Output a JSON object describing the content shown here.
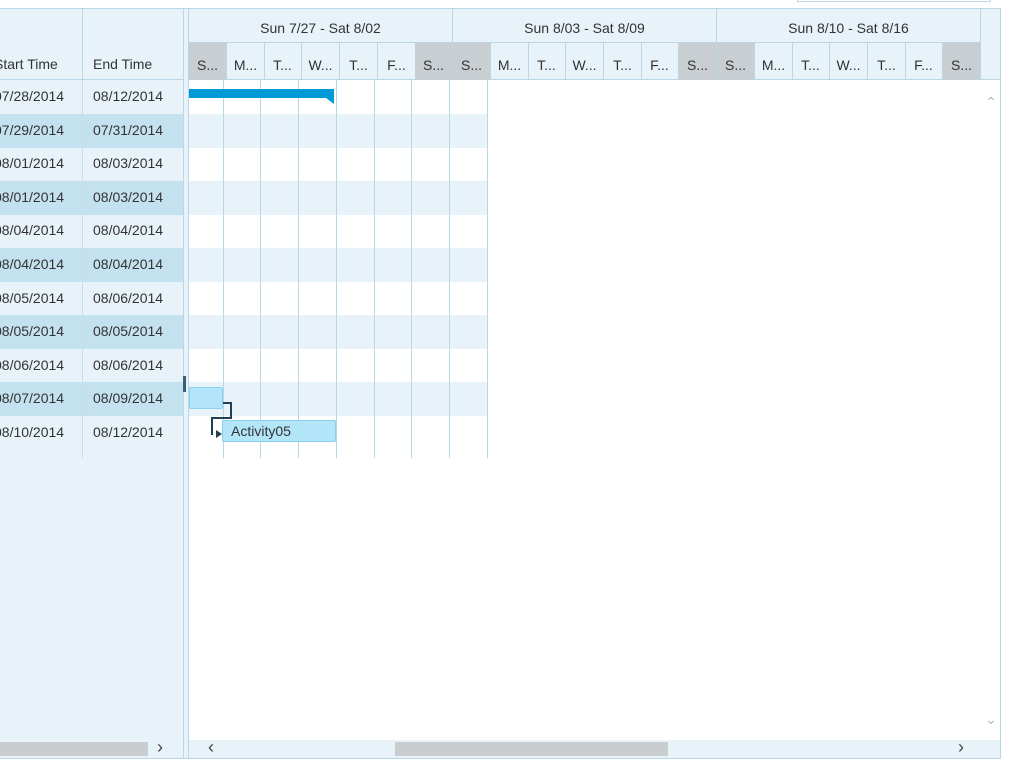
{
  "grid": {
    "columns": {
      "start_time": "Start Time",
      "end_time": "End Time"
    },
    "rows": [
      {
        "start": "07/28/2014",
        "end": "08/12/2014"
      },
      {
        "start": "07/29/2014",
        "end": "07/31/2014"
      },
      {
        "start": "08/01/2014",
        "end": "08/03/2014"
      },
      {
        "start": "08/01/2014",
        "end": "08/03/2014"
      },
      {
        "start": "08/04/2014",
        "end": "08/04/2014"
      },
      {
        "start": "08/04/2014",
        "end": "08/04/2014"
      },
      {
        "start": "08/05/2014",
        "end": "08/06/2014"
      },
      {
        "start": "08/05/2014",
        "end": "08/05/2014"
      },
      {
        "start": "08/06/2014",
        "end": "08/06/2014"
      },
      {
        "start": "08/07/2014",
        "end": "08/09/2014"
      },
      {
        "start": "08/10/2014",
        "end": "08/12/2014"
      }
    ],
    "scroll_right_glyph": "›"
  },
  "timeline": {
    "weeks": [
      "Sun 7/27 - Sat 8/02",
      "Sun 8/03 - Sat 8/09",
      "Sun 8/10 - Sat 8/16"
    ],
    "days": [
      "S...",
      "M...",
      "T...",
      "W...",
      "T...",
      "F...",
      "S...",
      "S...",
      "M...",
      "T...",
      "W...",
      "T...",
      "F...",
      "S...",
      "S...",
      "M...",
      "T...",
      "W...",
      "T...",
      "F...",
      "S..."
    ],
    "weekend_flags": [
      true,
      false,
      false,
      false,
      false,
      false,
      true,
      true,
      false,
      false,
      false,
      false,
      false,
      true,
      true,
      false,
      false,
      false,
      false,
      false,
      true
    ]
  },
  "tasks": {
    "activity05_label": "Activity05"
  },
  "scroll": {
    "up_glyph": "⌃",
    "down_glyph": "⌄",
    "left_glyph": "‹",
    "right_glyph": "›"
  },
  "colors": {
    "summary_bar": "#009ad7",
    "task_bar": "#b3e5f9",
    "header_bg": "#e8f3f9",
    "weekend_bg": "#c8ced2"
  }
}
